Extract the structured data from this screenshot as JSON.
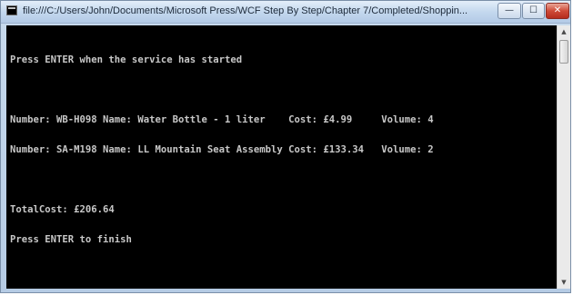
{
  "window": {
    "title": "file:///C:/Users/John/Documents/Microsoft Press/WCF Step By Step/Chapter 7/Completed/Shoppin...",
    "controls": {
      "minimize": "—",
      "maximize": "☐",
      "close": "✕"
    }
  },
  "console": {
    "lines": [
      "Press ENTER when the service has started",
      "",
      "Number: WB-H098 Name: Water Bottle - 1 liter    Cost: £4.99     Volume: 4",
      "Number: SA-M198 Name: LL Mountain Seat Assembly Cost: £133.34   Volume: 2",
      "",
      "TotalCost: £206.64",
      "Press ENTER to finish"
    ]
  },
  "scrollbar": {
    "up_arrow": "▲",
    "down_arrow": "▼"
  }
}
